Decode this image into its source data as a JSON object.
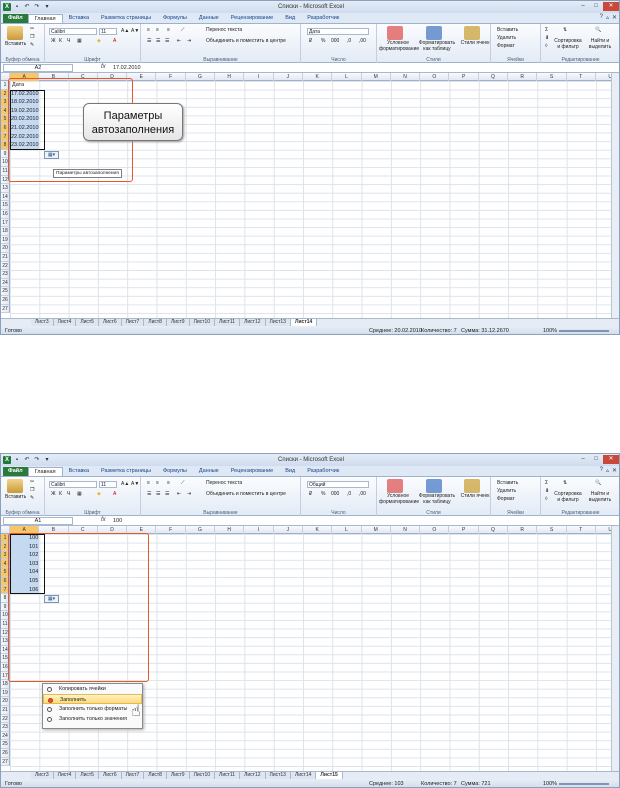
{
  "windows": [
    {
      "title": "Списки - Microsoft Excel",
      "tabs": [
        "Файл",
        "Главная",
        "Вставка",
        "Разметка страницы",
        "Формулы",
        "Данные",
        "Рецензирование",
        "Вид",
        "Разработчик"
      ],
      "font_name": "Calibri",
      "font_size": "11",
      "number_format": "Дата",
      "name_box": "A2",
      "formula": "17.02.2010",
      "header_cell": "Дата",
      "values": [
        "17.02.2010",
        "18.02.2010",
        "19.02.2010",
        "20.02.2010",
        "21.02.2010",
        "22.02.2010",
        "23.02.2010"
      ],
      "sheets": [
        "Лист3",
        "Лист4",
        "Лист5",
        "Лист6",
        "Лист7",
        "Лист8",
        "Лист9",
        "Лист10",
        "Лист11",
        "Лист12",
        "Лист13",
        "Лист14"
      ],
      "status": {
        "ready": "Готово",
        "average": "Среднее: 20.02.2010",
        "count": "Количество: 7",
        "sum": "Сумма: 31.12.2670",
        "zoom": "100%"
      },
      "callout": "Параметры автозаполнения",
      "tooltip": "Параметры автозаполнения"
    },
    {
      "title": "Списки - Microsoft Excel",
      "tabs": [
        "Файл",
        "Главная",
        "Вставка",
        "Разметка страницы",
        "Формулы",
        "Данные",
        "Рецензирование",
        "Вид",
        "Разработчик"
      ],
      "font_name": "Calibri",
      "font_size": "11",
      "number_format": "Общий",
      "name_box": "A1",
      "formula": "100",
      "values": [
        "100",
        "101",
        "102",
        "103",
        "104",
        "105",
        "106"
      ],
      "sheets": [
        "Лист3",
        "Лист4",
        "Лист5",
        "Лист6",
        "Лист7",
        "Лист8",
        "Лист9",
        "Лист10",
        "Лист11",
        "Лист12",
        "Лист13",
        "Лист14",
        "Лист15"
      ],
      "status": {
        "ready": "Готово",
        "average": "Среднее: 103",
        "count": "Количество: 7",
        "sum": "Сумма: 721",
        "zoom": "100%"
      },
      "menu": [
        "Копировать ячейки",
        "Заполнить",
        "Заполнить только форматы",
        "Заполнить только значения"
      ]
    }
  ],
  "ribbon": {
    "paste": "Вставить",
    "clipboard": "Буфер обмена",
    "font": "Шрифт",
    "alignment": "Выравнивание",
    "wrap": "Перенос текста",
    "merge": "Объединить и поместить в центре",
    "number": "Число",
    "cond_format": "Условное форматирование",
    "format_table": "Форматировать как таблицу",
    "cell_styles": "Стили ячеек",
    "styles": "Стили",
    "insert": "Вставить",
    "delete": "Удалить",
    "format": "Формат",
    "cells": "Ячейки",
    "sort": "Сортировка и фильтр",
    "find": "Найти и выделить",
    "editing": "Редактирование"
  },
  "columns": [
    "A",
    "B",
    "C",
    "D",
    "E",
    "F",
    "G",
    "H",
    "I",
    "J",
    "K",
    "L",
    "M",
    "N",
    "O",
    "P",
    "Q",
    "R",
    "S",
    "T",
    "U"
  ],
  "colors": {
    "accent_red": "#e8552a",
    "file_tab": "#2a7a3b",
    "selection": "#c5d9f1",
    "header_hl": "#f6c66a"
  }
}
